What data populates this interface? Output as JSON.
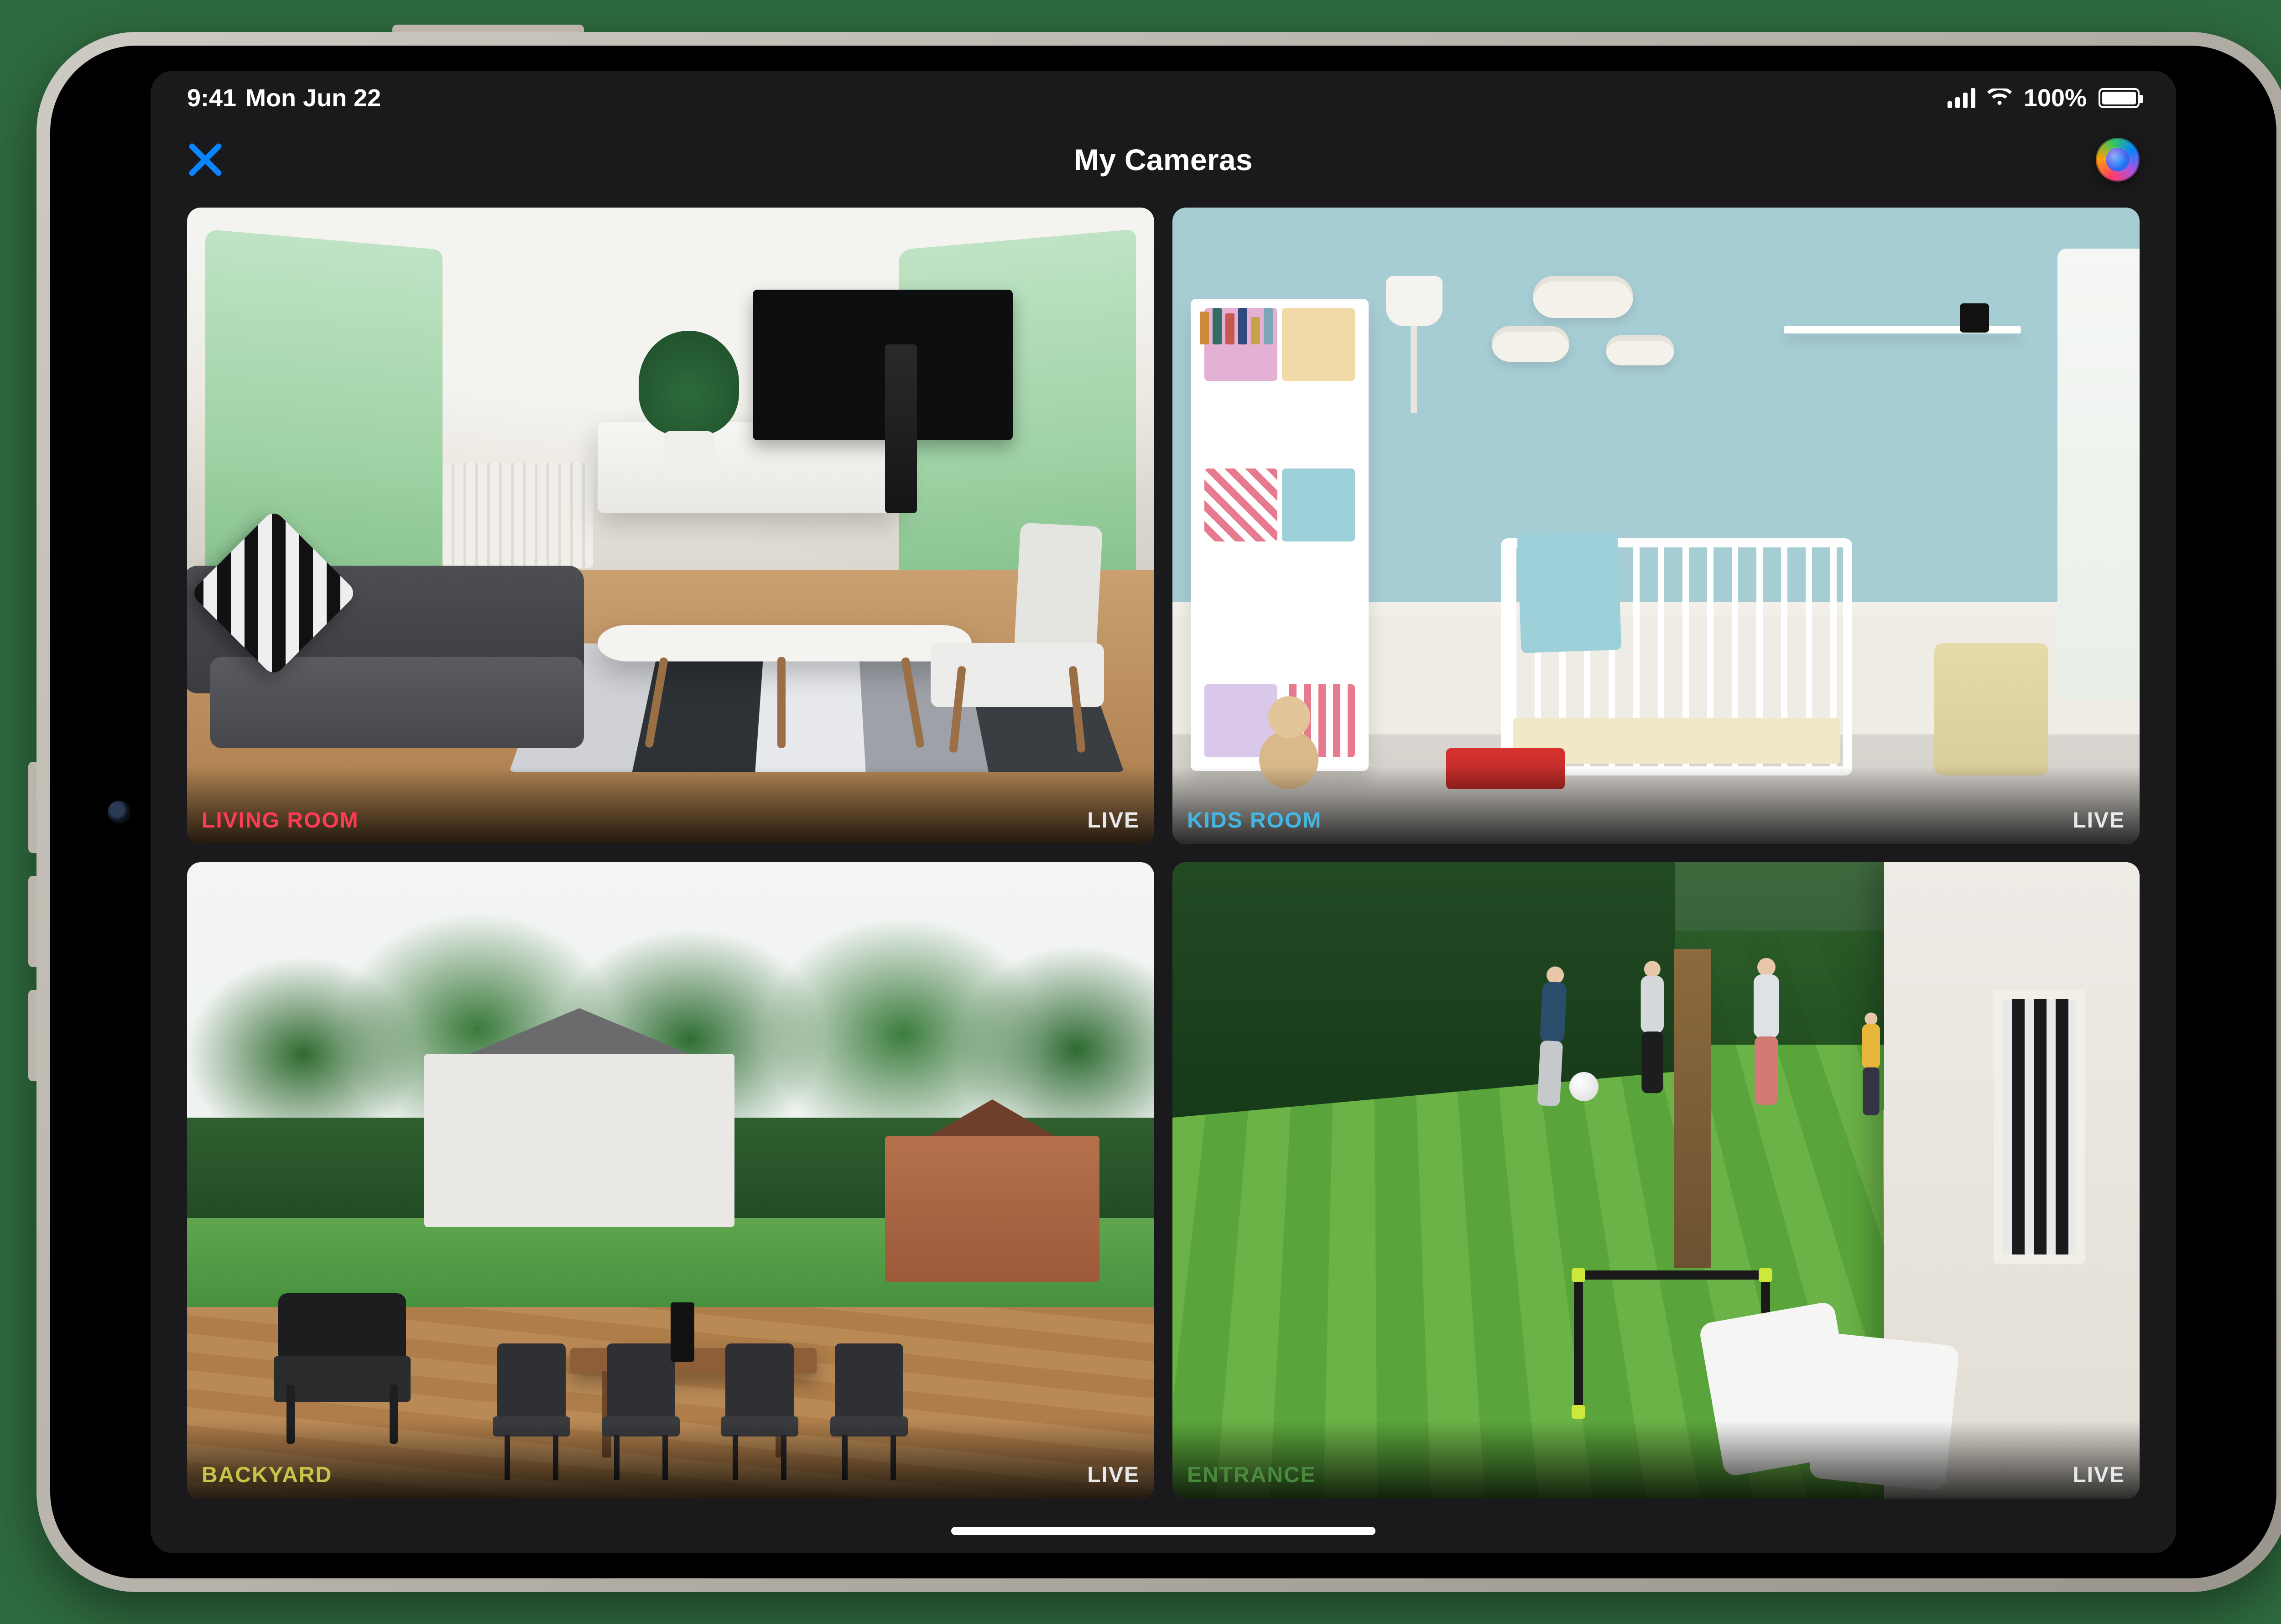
{
  "status": {
    "time": "9:41",
    "date": "Mon Jun 22",
    "battery_percent": "100%"
  },
  "header": {
    "title": "My Cameras"
  },
  "cameras": [
    {
      "name": "LIVING ROOM",
      "status": "LIVE",
      "label_color": "#ff3b55"
    },
    {
      "name": "KIDS ROOM",
      "status": "LIVE",
      "label_color": "#43b7e1"
    },
    {
      "name": "BACKYARD",
      "status": "LIVE",
      "label_color": "#c3c64a"
    },
    {
      "name": "ENTRANCE",
      "status": "LIVE",
      "label_color": "#4a8a3d"
    }
  ]
}
